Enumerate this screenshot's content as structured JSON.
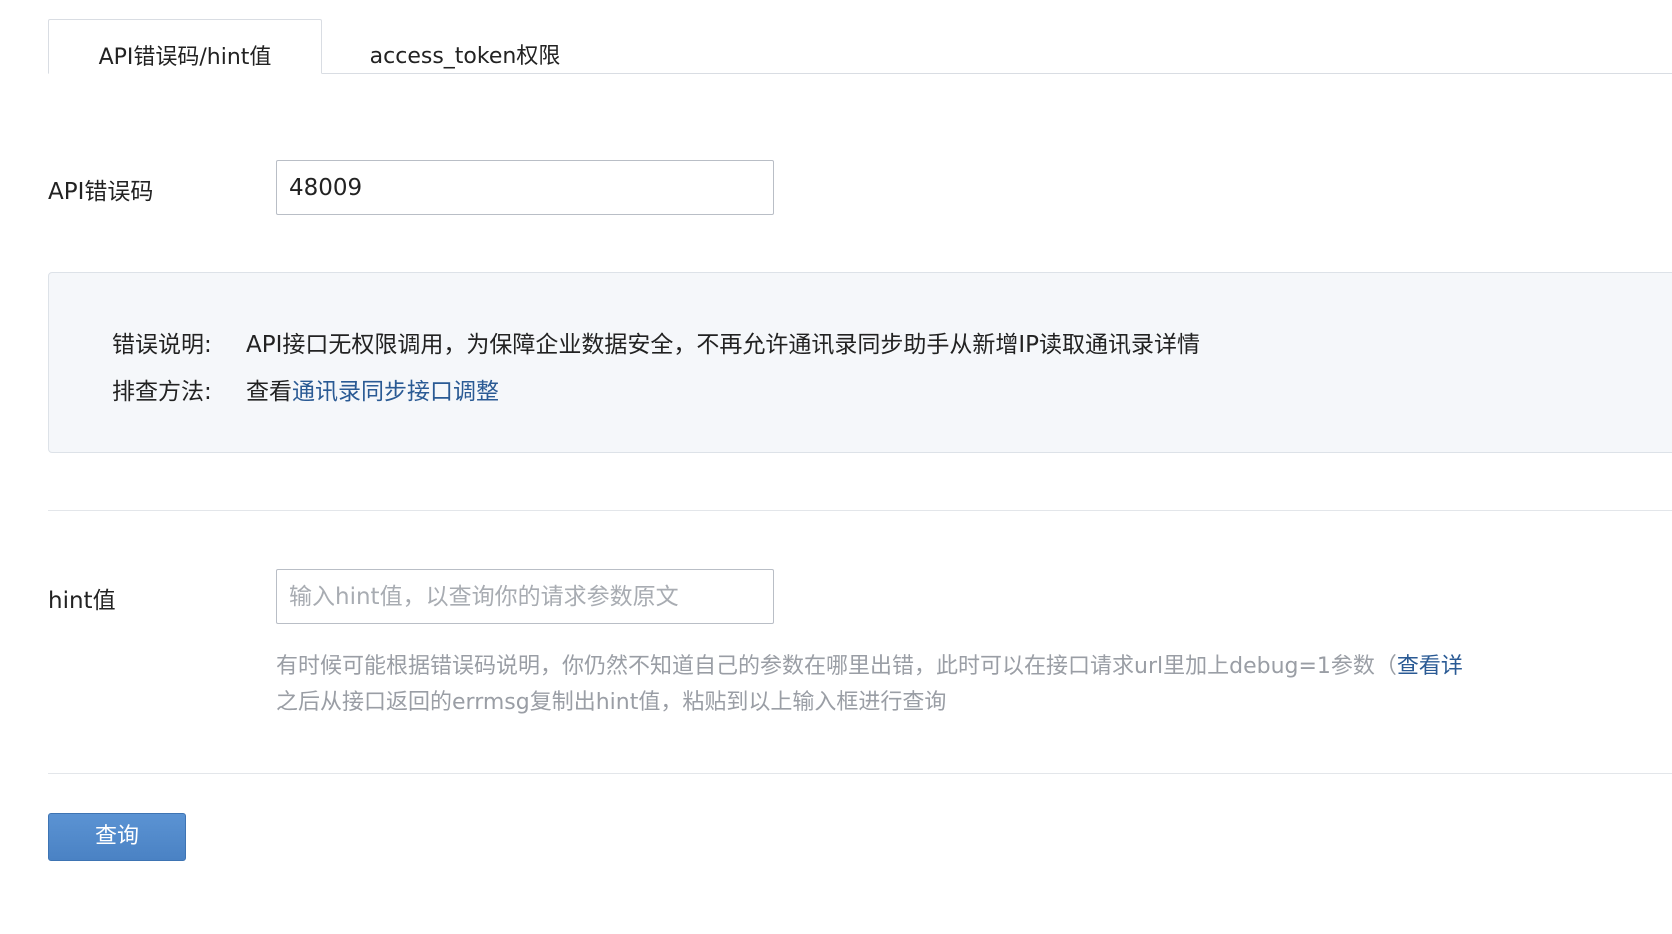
{
  "tabs": [
    {
      "label": "API错误码/hint值",
      "active": true
    },
    {
      "label": "access_token权限",
      "active": false
    }
  ],
  "error_code": {
    "label": "API错误码",
    "value": "48009"
  },
  "result": {
    "desc_key": "错误说明:",
    "desc_value": "API接口无权限调用，为保障企业数据安全，不再允许通讯录同步助手从新增IP读取通讯录详情",
    "fix_key": "排查方法:",
    "fix_prefix": "查看",
    "fix_link": "通讯录同步接口调整"
  },
  "hint": {
    "label": "hint值",
    "placeholder": "输入hint值，以查询你的请求参数原文",
    "value": "",
    "note_line1_text": "有时候可能根据错误码说明，你仍然不知道自己的参数在哪里出错，此时可以在接口请求url里加上debug=1参数（",
    "note_line1_link": "查看详",
    "note_line2": "之后从接口返回的errmsg复制出hint值，粘贴到以上输入框进行查询"
  },
  "submit": {
    "label": "查询"
  },
  "colors": {
    "link": "#2a5a94",
    "button": "#4a82c4",
    "info_bg": "#f5f7fa"
  }
}
